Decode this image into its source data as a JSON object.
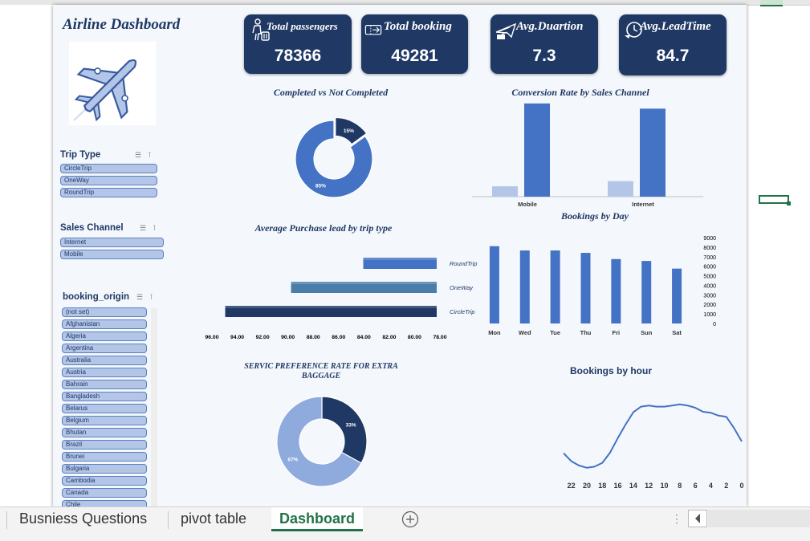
{
  "dashboard": {
    "title": "Airline Dashboard"
  },
  "kpis": [
    {
      "label": "Total passengers",
      "value": "78366",
      "icon": "passenger-luggage-icon"
    },
    {
      "label": "Total booking",
      "value": "49281",
      "icon": "ticket-icon"
    },
    {
      "label": "Avg.Duartion",
      "value": "7.3",
      "icon": "airplane-ticket-icon"
    },
    {
      "label": "Avg.LeadTime",
      "value": "84.7",
      "icon": "clock-icon"
    }
  ],
  "slicers": {
    "trip_type": {
      "title": "Trip Type",
      "items": [
        "CircleTrip",
        "OneWay",
        "RoundTrip"
      ]
    },
    "sales_channel": {
      "title": "Sales Channel",
      "items": [
        "Internet",
        "Mobile"
      ]
    },
    "booking_origin": {
      "title": "booking_origin",
      "items": [
        "(not set)",
        "Afghanistan",
        "Algeria",
        "Argentina",
        "Australia",
        "Austria",
        "Bahrain",
        "Bangladesh",
        "Belarus",
        "Belgium",
        "Bhutan",
        "Brazil",
        "Brunei",
        "Bulgaria",
        "Cambodia",
        "Canada",
        "Chile"
      ]
    }
  },
  "colors": {
    "navy": "#1f3864",
    "blue": "#4472c4",
    "light_blue": "#b4c6e7",
    "pale_blue": "#8faadc",
    "teal": "#4a7ea8",
    "excel_green": "#217346"
  },
  "sheet_tabs": {
    "tab1": "Busniess Questions",
    "tab2": "pivot table",
    "tab3": "Dashboard",
    "add_icon": "plus-circle-icon",
    "scroll_icon": "chevron-left-icon"
  },
  "chart_data": [
    {
      "id": "completed",
      "type": "pie",
      "title": "Completed vs Not Completed",
      "slices": [
        {
          "label": "85%",
          "value": 85,
          "color": "#4472c4"
        },
        {
          "label": "15%",
          "value": 15,
          "color": "#1f3864"
        }
      ]
    },
    {
      "id": "conversion",
      "type": "bar",
      "title": "Conversion  Rate by Sales Channel",
      "categories": [
        "Mobile",
        "Internet"
      ],
      "series": [
        {
          "values": [
            10,
            15
          ],
          "color": "#b4c6e7"
        },
        {
          "values": [
            90,
            85
          ],
          "color": "#4472c4"
        }
      ],
      "ylim": [
        0,
        100
      ],
      "yticks": [
        "0.00%",
        "10.00%",
        "20.00%",
        "30.00%",
        "40.00%",
        "50.00%",
        "60.00%",
        "70.00%",
        "80.00%",
        "90.00%",
        "100.00%"
      ]
    },
    {
      "id": "purchase_lead",
      "type": "bar",
      "orientation": "horizontal",
      "title": "Average Purchase lead by trip type",
      "categories": [
        "RoundTrip",
        "OneWay",
        "CircleTrip"
      ],
      "values": [
        83.8,
        89.5,
        94.7
      ],
      "colors": [
        "#4472c4",
        "#4a7ea8",
        "#1f3864"
      ],
      "axis_reversed": true,
      "xlim": [
        78,
        96
      ],
      "xticks": [
        "96.00",
        "94.00",
        "92.00",
        "90.00",
        "88.00",
        "86.00",
        "84.00",
        "82.00",
        "80.00",
        "78.00"
      ]
    },
    {
      "id": "by_day",
      "type": "bar",
      "title": "Bookings by Day",
      "categories": [
        "Mon",
        "Wed",
        "Tue",
        "Thu",
        "Fri",
        "Sun",
        "Sat"
      ],
      "values": [
        8100,
        7650,
        7650,
        7400,
        6750,
        6550,
        5750
      ],
      "color": "#4472c4",
      "ylim": [
        0,
        9000
      ],
      "yticks": [
        "0",
        "1000",
        "2000",
        "3000",
        "4000",
        "5000",
        "6000",
        "7000",
        "8000",
        "9000"
      ]
    },
    {
      "id": "baggage",
      "type": "pie",
      "title": "SERVIC PREFERENCE RATE FOR EXTRA BAGGAGE",
      "slices": [
        {
          "label": "33%",
          "value": 33,
          "color": "#1f3864"
        },
        {
          "label": "67%",
          "value": 67,
          "color": "#8faadc"
        }
      ]
    },
    {
      "id": "by_hour",
      "type": "line",
      "title": "Bookings by hour",
      "x": [
        23,
        22,
        21,
        20,
        19,
        18,
        17,
        16,
        15,
        14,
        13,
        12,
        11,
        10,
        9,
        8,
        7,
        6,
        5,
        4,
        3,
        2,
        1,
        0
      ],
      "values": [
        980,
        620,
        430,
        330,
        380,
        550,
        1000,
        1650,
        2250,
        2800,
        3050,
        3100,
        3050,
        3050,
        3100,
        3150,
        3100,
        3000,
        2820,
        2780,
        2650,
        2600,
        2100,
        1500
      ],
      "color": "#4472c4",
      "xticks": [
        "22",
        "20",
        "18",
        "16",
        "14",
        "12",
        "10",
        "8",
        "6",
        "4",
        "2",
        "0"
      ],
      "ylim": [
        0,
        3500
      ],
      "yticks": [
        "0",
        "500",
        "1000",
        "1500",
        "2000",
        "2500",
        "3000",
        "3500"
      ]
    }
  ]
}
